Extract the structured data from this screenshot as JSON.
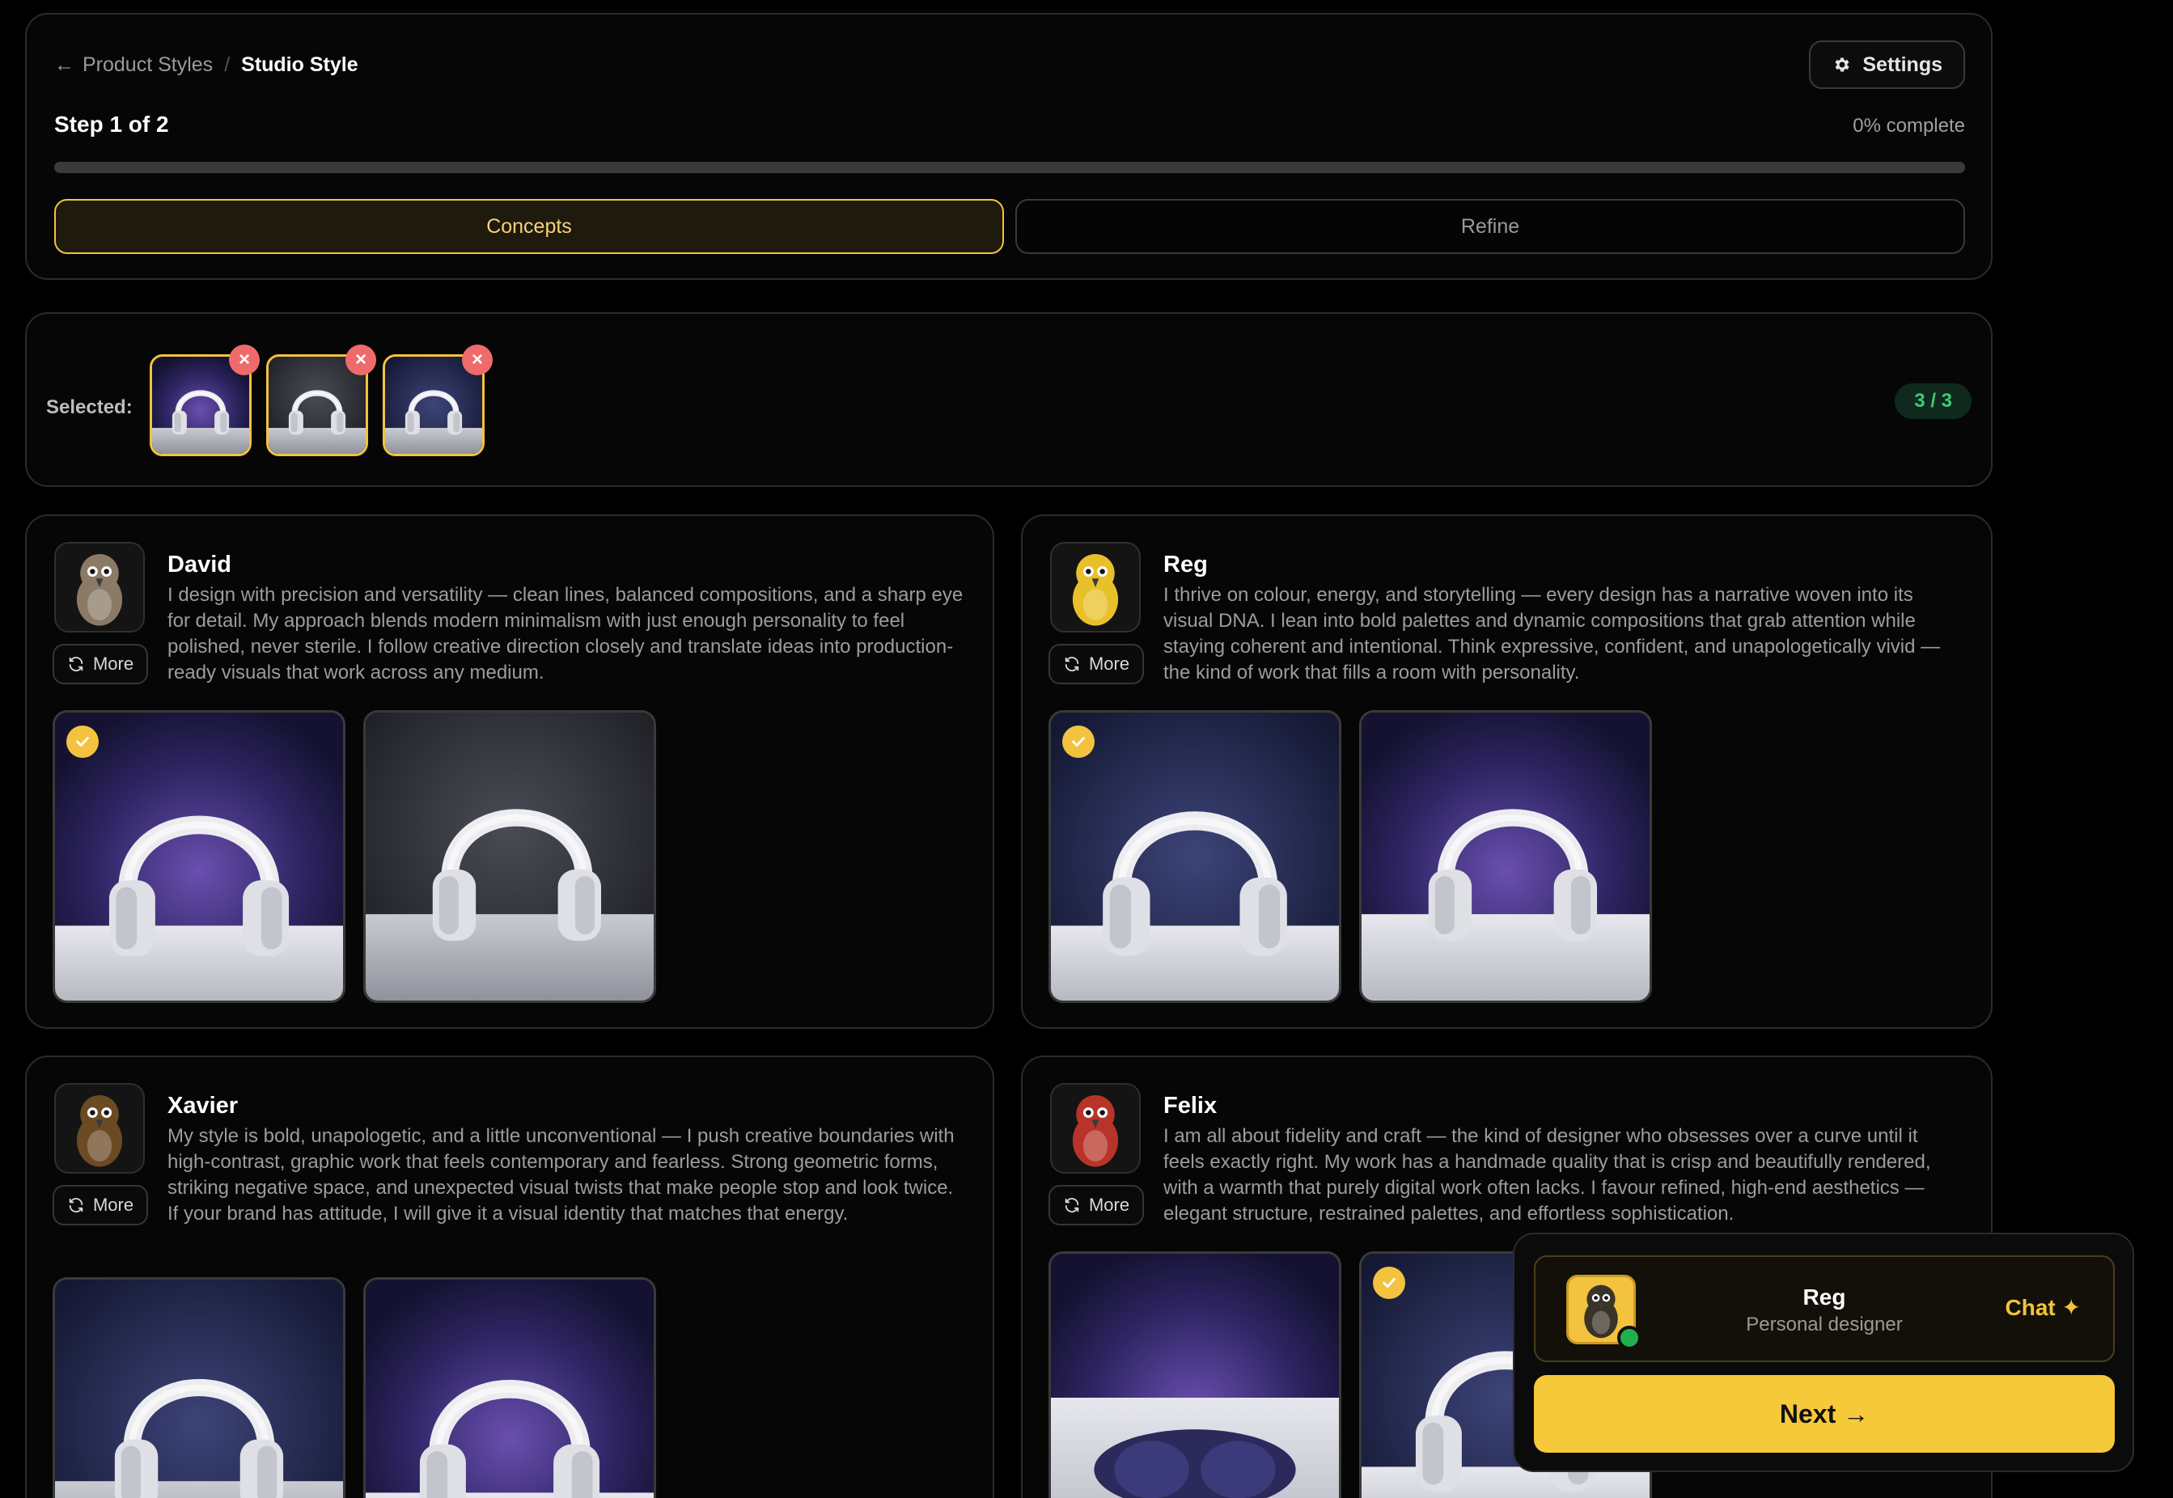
{
  "header": {
    "back_label": "Product Styles",
    "current_label": "Studio Style",
    "settings_label": "Settings",
    "step_label": "Step 1 of 2",
    "progress_text": "0% complete",
    "progress_fraction": 0,
    "tabs": [
      {
        "label": "Concepts",
        "active": true
      },
      {
        "label": "Refine",
        "active": false
      }
    ]
  },
  "selected": {
    "label": "Selected:",
    "count": "3 / 3"
  },
  "designers": [
    {
      "name": "David",
      "more_label": "More",
      "bio": "I design with precision and versatility — clean lines, balanced compositions, and a sharp eye for detail. My approach blends modern minimalism with just enough personality to feel polished, never sterile. I follow creative direction closely and translate ideas into production-ready visuals that work across any medium."
    },
    {
      "name": "Reg",
      "more_label": "More",
      "bio": "I thrive on colour, energy, and storytelling — every design has a narrative woven into its visual DNA. I lean into bold palettes and dynamic compositions that grab attention while staying coherent and intentional. Think expressive, confident, and unapologetically vivid — the kind of work that fills a room with personality."
    },
    {
      "name": "Xavier",
      "more_label": "More",
      "bio": "My style is bold, unapologetic, and a little unconventional — I push creative boundaries with high-contrast, graphic work that feels contemporary and fearless. Strong geometric forms, striking negative space, and unexpected visual twists that make people stop and look twice. If your brand has attitude, I will give it a visual identity that matches that energy."
    },
    {
      "name": "Felix",
      "more_label": "More",
      "bio": "I am all about fidelity and craft — the kind of designer who obsesses over a curve until it feels exactly right. My work has a handmade quality that is crisp and beautifully rendered, with a warmth that purely digital work often lacks. I favour refined, high-end aesthetics — elegant structure, restrained palettes, and effortless sophistication."
    }
  ],
  "chat": {
    "name": "Reg",
    "role": "Personal designer",
    "chat_label": "Chat ✦",
    "next_label": "Next →"
  },
  "colors": {
    "accent": "#f3c33f",
    "remove": "#ef6b6b",
    "success": "#3fca77",
    "online": "#22b04f"
  }
}
